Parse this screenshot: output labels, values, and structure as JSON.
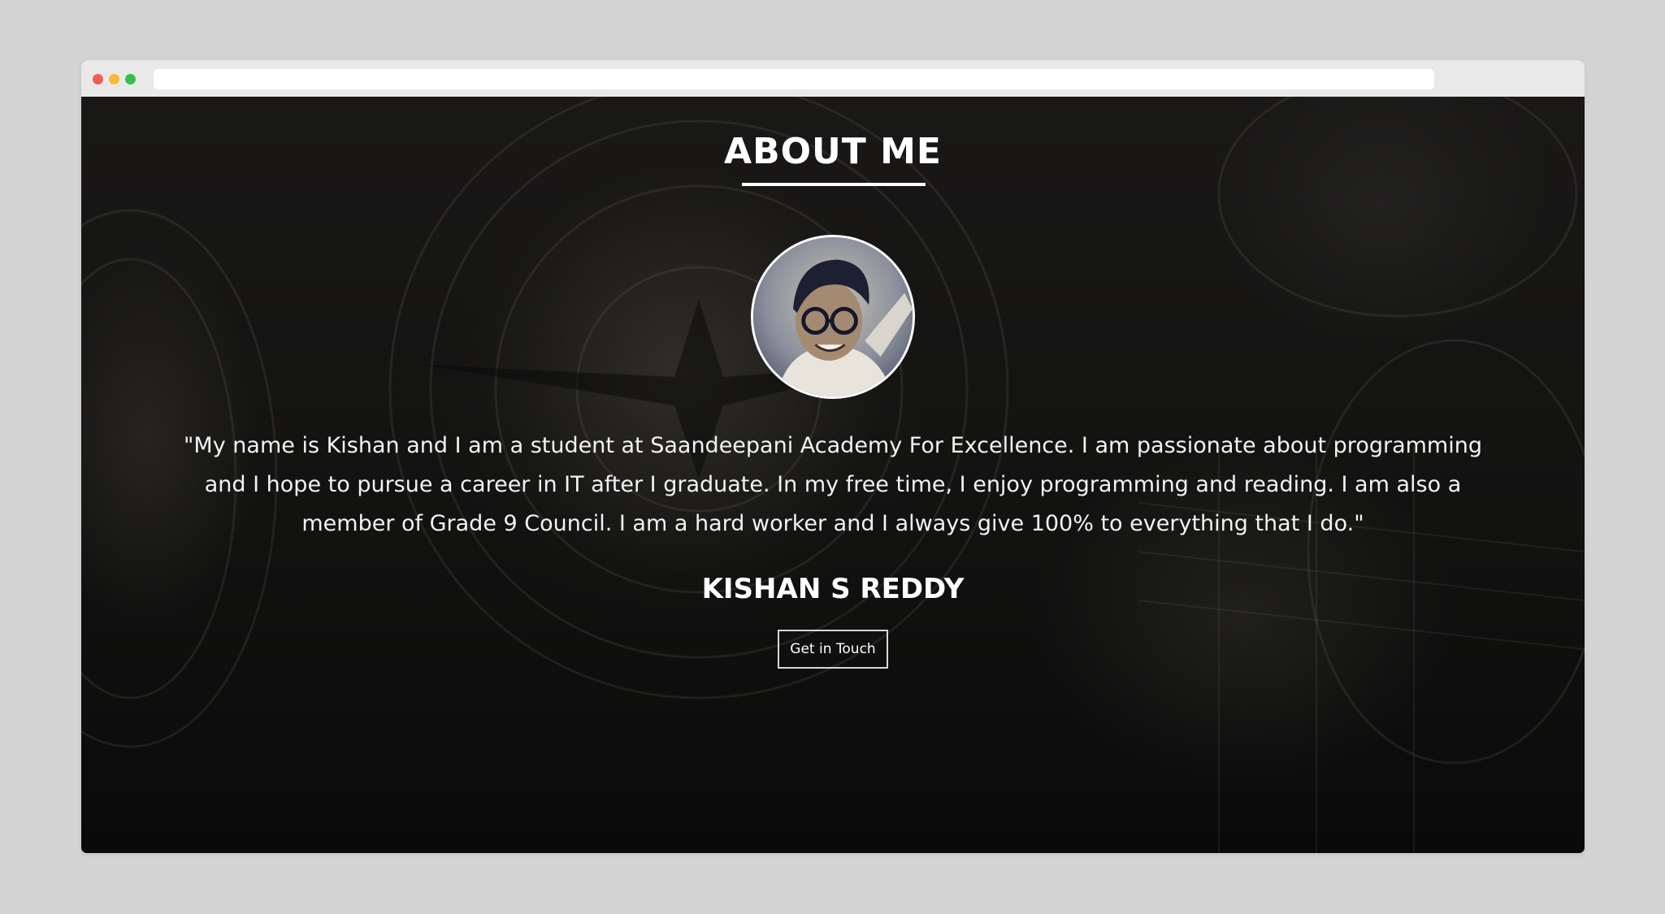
{
  "browser": {
    "url": ""
  },
  "about": {
    "heading": "ABOUT ME",
    "quote": "\"My name is Kishan and I am a student at Saandeepani Academy For Excellence. I am passionate about programming and I hope to pursue a career in IT after I graduate. In my free time, I enjoy programming and reading. I am also a member of Grade 9 Council. I am a hard worker and I always give 100% to everything that I do.\"",
    "name": "KISHAN S REDDY",
    "cta_label": "Get in Touch"
  },
  "colors": {
    "page_bg": "#d3d3d3",
    "titlebar": "#e9e9e9",
    "dot_red": "#f05e56",
    "dot_yellow": "#f6bb35",
    "dot_green": "#35c04a",
    "hero_bg": "#0d0d0d",
    "text": "#ffffff"
  },
  "icons": {
    "avatar": "profile-photo"
  }
}
